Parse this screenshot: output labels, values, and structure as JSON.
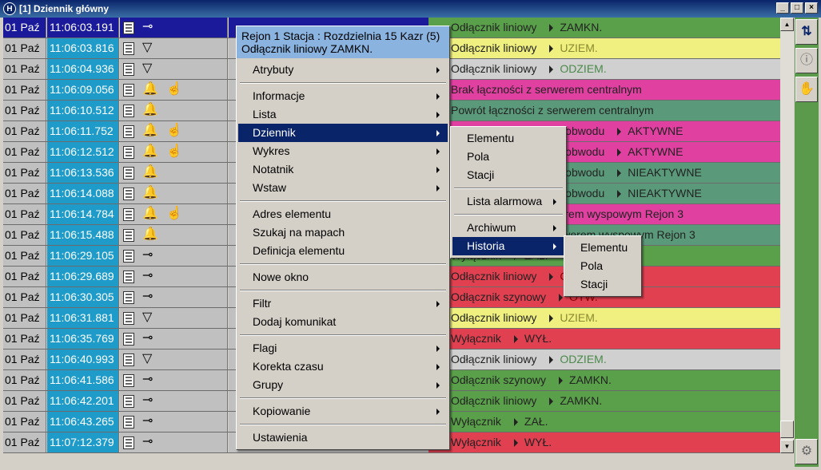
{
  "window": {
    "title": "[1] Dziennik główny",
    "app_icon": "H"
  },
  "rows": [
    {
      "date": "01 Paź",
      "time": "11:06:03.191",
      "sym": "⊸",
      "hand": false,
      "color": "#5aa04a",
      "mid": "",
      "desc": "Odłącznik liniowy",
      "arrow": true,
      "state": "ZAMKN.",
      "stateColor": "#222",
      "selected": true
    },
    {
      "date": "01 Paź",
      "time": "11:06:03.816",
      "sym": "▽",
      "hand": false,
      "color": "#f0f080",
      "mid": "",
      "desc": "Odłącznik liniowy",
      "arrow": true,
      "state": "UZIEM.",
      "stateColor": "#8a8a30",
      "selected": false
    },
    {
      "date": "01 Paź",
      "time": "11:06:04.936",
      "sym": "▽",
      "hand": false,
      "color": "#d0d0d0",
      "mid": "",
      "desc": "Odłącznik liniowy",
      "arrow": true,
      "state": "ODZIEM.",
      "stateColor": "#4a8a4a",
      "selected": false
    },
    {
      "date": "01 Paź",
      "time": "11:06:09.056",
      "sym": "🔔",
      "hand": true,
      "color": "#e040a0",
      "mid": "",
      "desc": "Brak łączności z serwerem centralnym",
      "arrow": false,
      "state": "",
      "stateColor": "#222",
      "selected": false
    },
    {
      "date": "01 Paź",
      "time": "11:06:10.512",
      "sym": "🔔",
      "hand": false,
      "color": "#5a9a7a",
      "mid": "",
      "desc": "Powrót łączności z serwerem centralnym",
      "arrow": false,
      "state": "",
      "stateColor": "#222",
      "selected": false
    },
    {
      "date": "01 Paź",
      "time": "11:06:11.752",
      "sym": "🔔",
      "hand": true,
      "color": "#e040a0",
      "mid": "",
      "desc": "Brak napięcia pomiaru obwodu",
      "arrow": true,
      "state": "AKTYWNE",
      "stateColor": "#222",
      "selected": false
    },
    {
      "date": "01 Paź",
      "time": "11:06:12.512",
      "sym": "🔔",
      "hand": true,
      "color": "#e040a0",
      "mid": "",
      "desc": "Brak napięcia pomiaru obwodu",
      "arrow": true,
      "state": "AKTYWNE",
      "stateColor": "#222",
      "selected": false
    },
    {
      "date": "01 Paź",
      "time": "11:06:13.536",
      "sym": "🔔",
      "hand": false,
      "color": "#5a9a7a",
      "mid": "",
      "desc": "Brak napięcia pomiaru obwodu",
      "arrow": true,
      "state": "NIEAKTYWNE",
      "stateColor": "#222",
      "selected": false
    },
    {
      "date": "01 Paź",
      "time": "11:06:14.088",
      "sym": "🔔",
      "hand": false,
      "color": "#5a9a7a",
      "mid": "",
      "desc": "Brak napięcia pomiaru obwodu",
      "arrow": true,
      "state": "NIEAKTYWNE",
      "stateColor": "#222",
      "selected": false
    },
    {
      "date": "01 Paź",
      "time": "11:06:14.784",
      "sym": "🔔",
      "hand": true,
      "color": "#e040a0",
      "mid": "",
      "desc": "Brak łączności z serwerem wyspowym Rejon 3",
      "arrow": false,
      "state": "",
      "stateColor": "#222",
      "selected": false
    },
    {
      "date": "01 Paź",
      "time": "11:06:15.488",
      "sym": "🔔",
      "hand": false,
      "color": "#5a9a7a",
      "mid": "",
      "desc": "Powrót łączności z serwerem wyspowym Rejon 3",
      "arrow": false,
      "state": "",
      "stateColor": "#222",
      "selected": false
    },
    {
      "date": "01 Paź",
      "time": "11:06:29.105",
      "sym": "⊸",
      "hand": false,
      "color": "#5aa04a",
      "mid": "",
      "desc": "Wyłącznik",
      "arrow": true,
      "state": "ZAŁ.",
      "stateColor": "#222",
      "selected": false
    },
    {
      "date": "01 Paź",
      "time": "11:06:29.689",
      "sym": "⊸",
      "hand": false,
      "color": "#e04050",
      "mid": "",
      "desc": "Odłącznik liniowy",
      "arrow": true,
      "state": "OTW.",
      "stateColor": "#8a0000",
      "selected": false
    },
    {
      "date": "01 Paź",
      "time": "11:06:30.305",
      "sym": "⊸",
      "hand": false,
      "color": "#e04050",
      "mid": "",
      "desc": "Odłącznik szynowy",
      "arrow": true,
      "state": "OTW.",
      "stateColor": "#8a0000",
      "selected": false
    },
    {
      "date": "01 Paź",
      "time": "11:06:31.881",
      "sym": "▽",
      "hand": false,
      "color": "#f0f080",
      "mid": "",
      "desc": "Odłącznik liniowy",
      "arrow": true,
      "state": "UZIEM.",
      "stateColor": "#8a8a30",
      "selected": false
    },
    {
      "date": "01 Paź",
      "time": "11:06:35.769",
      "sym": "⊸",
      "hand": false,
      "color": "#e04050",
      "mid": "",
      "desc": "Wyłącznik",
      "arrow": true,
      "state": "WYŁ.",
      "stateColor": "#222",
      "selected": false
    },
    {
      "date": "01 Paź",
      "time": "11:06:40.993",
      "sym": "▽",
      "hand": false,
      "color": "#d0d0d0",
      "mid": "",
      "desc": "Odłącznik liniowy",
      "arrow": true,
      "state": "ODZIEM.",
      "stateColor": "#4a8a4a",
      "selected": false
    },
    {
      "date": "01 Paź",
      "time": "11:06:41.586",
      "sym": "⊸",
      "hand": false,
      "color": "#5aa04a",
      "mid": "",
      "desc": "Odłącznik szynowy",
      "arrow": true,
      "state": "ZAMKN.",
      "stateColor": "#222",
      "selected": false
    },
    {
      "date": "01 Paź",
      "time": "11:06:42.201",
      "sym": "⊸",
      "hand": false,
      "color": "#5aa04a",
      "mid": "",
      "desc": "Odłącznik liniowy",
      "arrow": true,
      "state": "ZAMKN.",
      "stateColor": "#222",
      "selected": false
    },
    {
      "date": "01 Paź",
      "time": "11:06:43.265",
      "sym": "⊸",
      "hand": false,
      "color": "#5aa04a",
      "mid": "",
      "desc": "Wyłącznik",
      "arrow": true,
      "state": "ZAŁ.",
      "stateColor": "#222",
      "selected": false
    },
    {
      "date": "01 Paź",
      "time": "11:07:12.379",
      "sym": "⊸",
      "hand": false,
      "color": "#e04050",
      "mid": "",
      "desc": "Wyłącznik",
      "arrow": true,
      "state": "WYŁ.",
      "stateColor": "#222",
      "selected": false
    }
  ],
  "context_menu": {
    "header_line1": "Rejon 1 Stacja : Rozdzielnia 15 Kazr (5)",
    "header_line2": "Odłącznik liniowy ZAMKN.",
    "items": [
      {
        "label": "Atrybuty",
        "sub": true,
        "hl": false,
        "sep_before": false
      },
      {
        "label": "Informacje",
        "sub": true,
        "hl": false,
        "sep_before": true
      },
      {
        "label": "Lista",
        "sub": true,
        "hl": false,
        "sep_before": false
      },
      {
        "label": "Dziennik",
        "sub": true,
        "hl": true,
        "sep_before": false
      },
      {
        "label": "Wykres",
        "sub": true,
        "hl": false,
        "sep_before": false
      },
      {
        "label": "Notatnik",
        "sub": true,
        "hl": false,
        "sep_before": false
      },
      {
        "label": "Wstaw",
        "sub": true,
        "hl": false,
        "sep_before": false
      },
      {
        "label": "Adres elementu",
        "sub": false,
        "hl": false,
        "sep_before": true
      },
      {
        "label": "Szukaj na mapach",
        "sub": false,
        "hl": false,
        "sep_before": false
      },
      {
        "label": "Definicja elementu",
        "sub": false,
        "hl": false,
        "sep_before": false
      },
      {
        "label": "Nowe okno",
        "sub": false,
        "hl": false,
        "sep_before": true
      },
      {
        "label": "Filtr",
        "sub": true,
        "hl": false,
        "sep_before": true
      },
      {
        "label": "Dodaj komunikat",
        "sub": false,
        "hl": false,
        "sep_before": false
      },
      {
        "label": "Flagi",
        "sub": true,
        "hl": false,
        "sep_before": true
      },
      {
        "label": "Korekta czasu",
        "sub": true,
        "hl": false,
        "sep_before": false
      },
      {
        "label": "Grupy",
        "sub": true,
        "hl": false,
        "sep_before": false
      },
      {
        "label": "Kopiowanie",
        "sub": true,
        "hl": false,
        "sep_before": true
      },
      {
        "label": "Ustawienia",
        "sub": false,
        "hl": false,
        "sep_before": true
      }
    ]
  },
  "submenu_dziennik": {
    "items": [
      {
        "label": "Elementu",
        "sub": false,
        "hl": false,
        "sep_before": false
      },
      {
        "label": "Pola",
        "sub": false,
        "hl": false,
        "sep_before": false
      },
      {
        "label": "Stacji",
        "sub": false,
        "hl": false,
        "sep_before": false
      },
      {
        "label": "Lista alarmowa",
        "sub": true,
        "hl": false,
        "sep_before": true
      },
      {
        "label": "Archiwum",
        "sub": true,
        "hl": false,
        "sep_before": true
      },
      {
        "label": "Historia",
        "sub": true,
        "hl": true,
        "sep_before": false
      }
    ]
  },
  "submenu_historia": {
    "items": [
      {
        "label": "Elementu",
        "sub": false,
        "hl": false,
        "sep_before": false
      },
      {
        "label": "Pola",
        "sub": false,
        "hl": false,
        "sep_before": false
      },
      {
        "label": "Stacji",
        "sub": false,
        "hl": false,
        "sep_before": false
      }
    ]
  }
}
